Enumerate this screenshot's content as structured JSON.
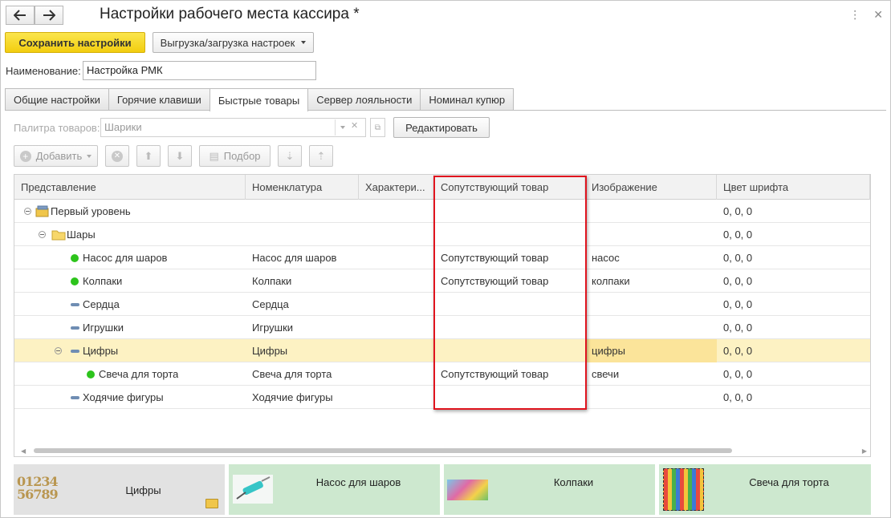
{
  "window": {
    "title": "Настройки рабочего места кассира *"
  },
  "toolbar": {
    "save_label": "Сохранить настройки",
    "export_label": "Выгрузка/загрузка настроек"
  },
  "name_field": {
    "label": "Наименование:",
    "value": "Настройка РМК"
  },
  "tabs": [
    {
      "label": "Общие настройки",
      "active": false
    },
    {
      "label": "Горячие клавиши",
      "active": false
    },
    {
      "label": "Быстрые товары",
      "active": true
    },
    {
      "label": "Сервер лояльности",
      "active": false
    },
    {
      "label": "Номинал купюр",
      "active": false
    }
  ],
  "palette_field": {
    "label": "Палитра товаров:",
    "value": "Шарики",
    "edit_label": "Редактировать"
  },
  "list_toolbar": {
    "add_label": "Добавить",
    "select_label": "Подбор"
  },
  "table": {
    "columns": [
      "Представление",
      "Номенклатура",
      "Характери...",
      "Сопутствующий товар",
      "Изображение",
      "Цвет шрифта"
    ],
    "rows": [
      {
        "level": 0,
        "icon": "folder-stack-icon",
        "name": "Первый уровень",
        "nom": "",
        "char": "",
        "related": "",
        "image": "",
        "color": "0, 0, 0",
        "selected": false
      },
      {
        "level": 1,
        "icon": "folder-icon",
        "name": "Шары",
        "nom": "",
        "char": "",
        "related": "",
        "image": "",
        "color": "0, 0, 0",
        "selected": false
      },
      {
        "level": 2,
        "icon": "green-dot-icon",
        "name": "Насос для шаров",
        "nom": "Насос для шаров",
        "char": "",
        "related": "Сопутствующий товар",
        "image": "насос",
        "color": "0, 0, 0",
        "selected": false
      },
      {
        "level": 2,
        "icon": "green-dot-icon",
        "name": "Колпаки",
        "nom": "Колпаки",
        "char": "",
        "related": "Сопутствующий товар",
        "image": "колпаки",
        "color": "0, 0, 0",
        "selected": false
      },
      {
        "level": 2,
        "icon": "dash-icon",
        "name": "Сердца",
        "nom": "Сердца",
        "char": "",
        "related": "",
        "image": "",
        "color": "0, 0, 0",
        "selected": false
      },
      {
        "level": 2,
        "icon": "dash-icon",
        "name": "Игрушки",
        "nom": "Игрушки",
        "char": "",
        "related": "",
        "image": "",
        "color": "0, 0, 0",
        "selected": false
      },
      {
        "level": 2,
        "icon": "dash-icon",
        "name": "Цифры",
        "nom": "Цифры",
        "char": "",
        "related": "",
        "image": "цифры",
        "color": "0, 0, 0",
        "selected": true
      },
      {
        "level": 3,
        "icon": "green-dot-icon",
        "name": "Свеча для торта",
        "nom": "Свеча для торта",
        "char": "",
        "related": "Сопутствующий товар",
        "image": "свечи",
        "color": "0, 0, 0",
        "selected": false
      },
      {
        "level": 2,
        "icon": "dash-icon",
        "name": "Ходячие фигуры",
        "nom": "Ходячие фигуры",
        "char": "",
        "related": "",
        "image": "",
        "color": "0, 0, 0",
        "selected": false
      }
    ]
  },
  "palette_tiles": [
    {
      "label": "Цифры",
      "picture_text": "01234 56789",
      "bg": "#e2e2e2"
    },
    {
      "label": "Насос для шаров",
      "bg": "#cde8cf"
    },
    {
      "label": "Колпаки",
      "bg": "#cde8cf"
    },
    {
      "label": "Свеча для торта",
      "bg": "#cde8cf"
    }
  ],
  "colors": {
    "accent_yellow": "#f5d318",
    "selection": "#fdf2c3",
    "highlight_cell": "#fbe49a",
    "red_frame": "#e0141e",
    "green_dot": "#2dc41c"
  }
}
